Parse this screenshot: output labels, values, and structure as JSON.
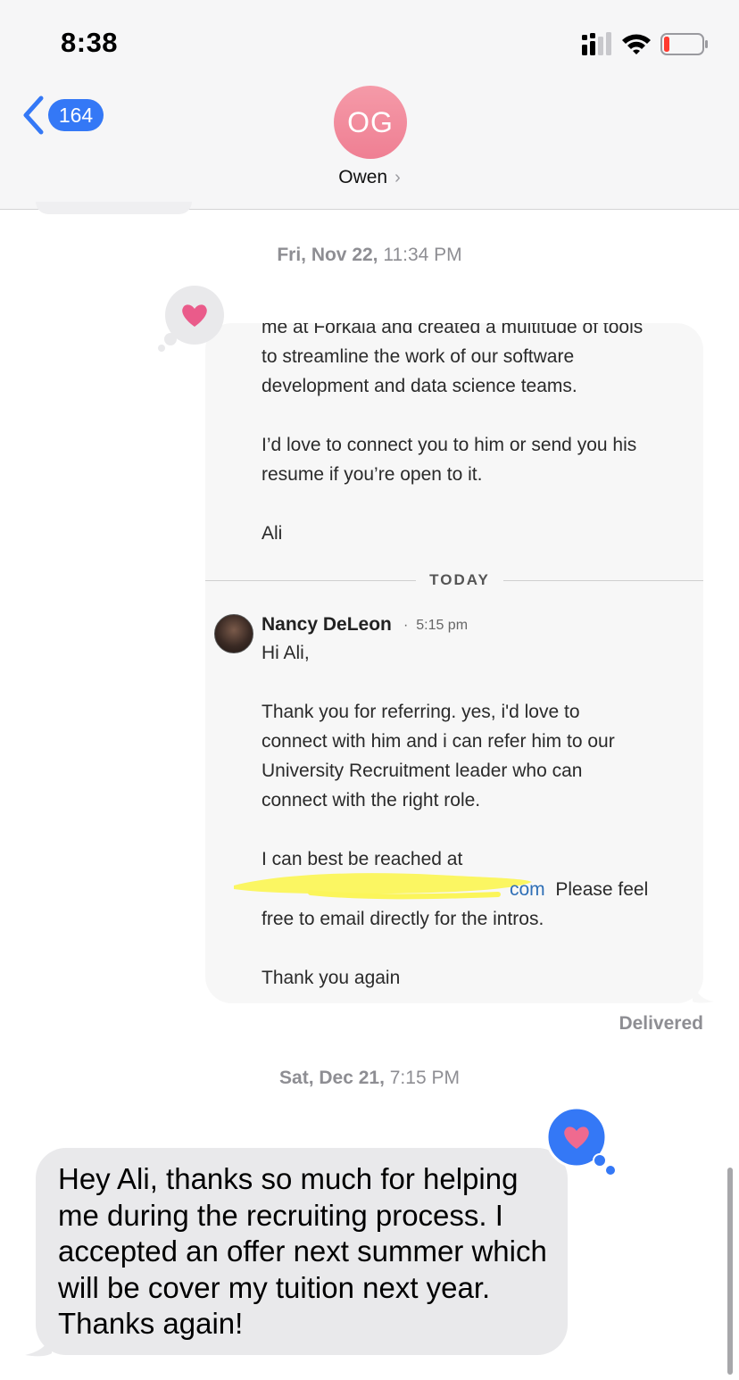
{
  "status_bar": {
    "time": "8:38",
    "signal_icon": "cellular-signal-icon",
    "wifi_icon": "wifi-icon",
    "battery_icon": "battery-low-icon",
    "battery_level": 0.1
  },
  "header": {
    "back_count": "164",
    "avatar_initials": "OG",
    "contact_name": "Owen",
    "contact_chevron": "›"
  },
  "thread": {
    "timestamp_1": {
      "day": "Fri, Nov 22,",
      "time": " 11:34 PM"
    },
    "screenshot_message": {
      "text_top": "me at Forkala and created a multitude of tools\nto streamline the work of our software\ndevelopment and data science teams.\n\nI’d love to connect you to him or send you his\nresume if you’re open to it.\n\nAli",
      "divider_label": "TODAY",
      "sender_name": "Nancy DeLeon",
      "sender_time": "5:15 pm",
      "reply_1": "Hi Ali,\n\nThank you for referring.  yes, i'd love to\nconnect with him and i can refer him to our\nUniversity Recruitment leader who can\nconnect with the right role.\n\nI can best be reached at",
      "email_link_tail": "com",
      "reply_2": "Please feel",
      "reply_3": "free to email directly for the intros.\n\nThank you again"
    },
    "tapback_left_icon": "heart-icon",
    "delivered_label": "Delivered",
    "timestamp_2": {
      "day": "Sat, Dec 21,",
      "time": " 7:15 PM"
    },
    "incoming_message": "Hey Ali, thanks so much for helping me during the recruiting process. I accepted an offer next summer which will be cover my tuition next year. Thanks again!",
    "tapback_right_icon": "heart-icon"
  },
  "colors": {
    "accent_blue": "#3478f6",
    "heart_pink": "#ea5b8a",
    "highlight_yellow": "#fbf55a"
  }
}
